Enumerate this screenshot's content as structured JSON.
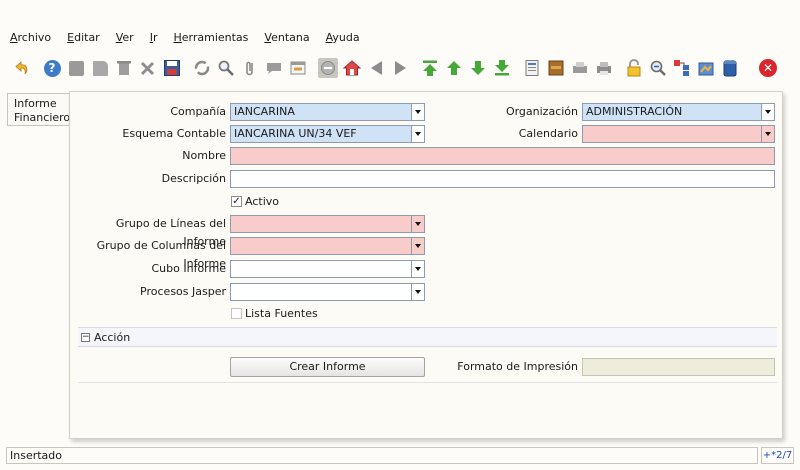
{
  "menu": [
    "Archivo",
    "Editar",
    "Ver",
    "Ir",
    "Herramientas",
    "Ventana",
    "Ayuda"
  ],
  "toolbar": {
    "icons": [
      "undo-icon",
      "help-icon",
      "new-record-icon",
      "copy-record-icon",
      "delete-icon",
      "delete-selection-icon",
      "save-icon",
      "refresh-icon",
      "find-icon",
      "attachment-icon",
      "chat-icon",
      "history-icon",
      "home-icon",
      "parent-icon",
      "previous-icon",
      "next-icon",
      "first-record-icon",
      "previous-record-icon",
      "next-record-icon",
      "last-record-icon",
      "report-icon",
      "archive-icon",
      "print-preview-icon",
      "print-icon",
      "lock-icon",
      "zoom-across-icon",
      "workflow-icon",
      "product-info-icon",
      "end-icon",
      "close-icon"
    ]
  },
  "tab": {
    "label_line1": "Informe",
    "label_line2": "Financiero"
  },
  "form": {
    "compania": {
      "label": "Compañía",
      "value": "IANCARINA"
    },
    "organizacion": {
      "label": "Organización",
      "value": "ADMINISTRACIÓN"
    },
    "esquema": {
      "label": "Esquema Contable",
      "value": "IANCARINA UN/34 VEF"
    },
    "calendario": {
      "label": "Calendario",
      "value": ""
    },
    "nombre": {
      "label": "Nombre",
      "value": ""
    },
    "descripcion": {
      "label": "Descripción",
      "value": ""
    },
    "activo": {
      "label": "Activo",
      "checked": true
    },
    "grupo_lineas": {
      "label": "Grupo de Líneas del Informe",
      "value": ""
    },
    "grupo_columnas": {
      "label": "Grupo de Columnas del Informe",
      "value": ""
    },
    "cubo": {
      "label": "Cubo Informe",
      "value": ""
    },
    "jasper": {
      "label": "Procesos Jasper",
      "value": ""
    },
    "lista_fuentes": {
      "label": "Lista Fuentes",
      "checked": false
    }
  },
  "section": {
    "toggle": "−",
    "label": "Acción"
  },
  "actions": {
    "crear_informe": "Crear Informe",
    "formato_label": "Formato de Impresión",
    "formato_value": ""
  },
  "status": {
    "text": "Insertado",
    "record": "+*2/7"
  },
  "colors": {
    "mandatory": "#f9cccc",
    "lookup": "#cfe2f6",
    "disabled": "#eeeddc",
    "accent": "#1f4fb4"
  }
}
